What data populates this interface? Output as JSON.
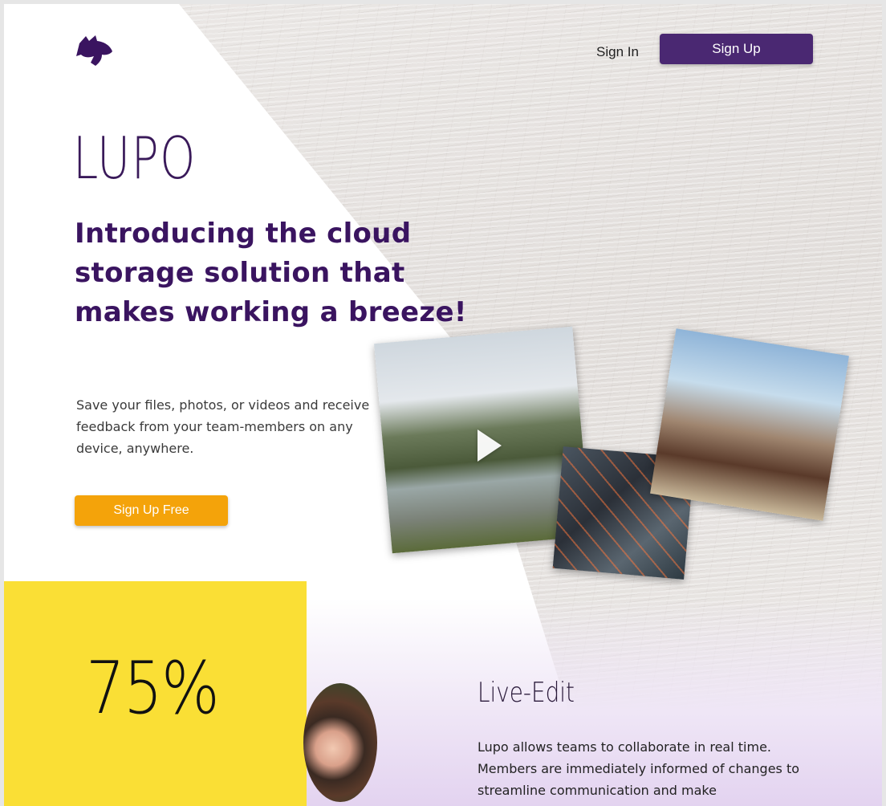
{
  "nav": {
    "sign_in": "Sign In",
    "sign_up": "Sign Up"
  },
  "hero": {
    "brand": "LUPO",
    "headline": "Introducing the cloud storage solution that makes working a breeze!",
    "subtext": "Save your files, photos, or videos and receive feedback from your team-members on any device, anywhere.",
    "cta": "Sign Up Free"
  },
  "icons": {
    "logo": "horse-head-logo",
    "play": "play-icon"
  },
  "stats": {
    "value": "75%"
  },
  "feature": {
    "title": "Live-Edit",
    "description": "Lupo allows teams to collaborate in real time. Members are immediately informed of changes to streamline communication and make"
  },
  "colors": {
    "brand_purple": "#4a2872",
    "cta_orange": "#f4a30a",
    "stat_yellow": "#fadf35"
  }
}
